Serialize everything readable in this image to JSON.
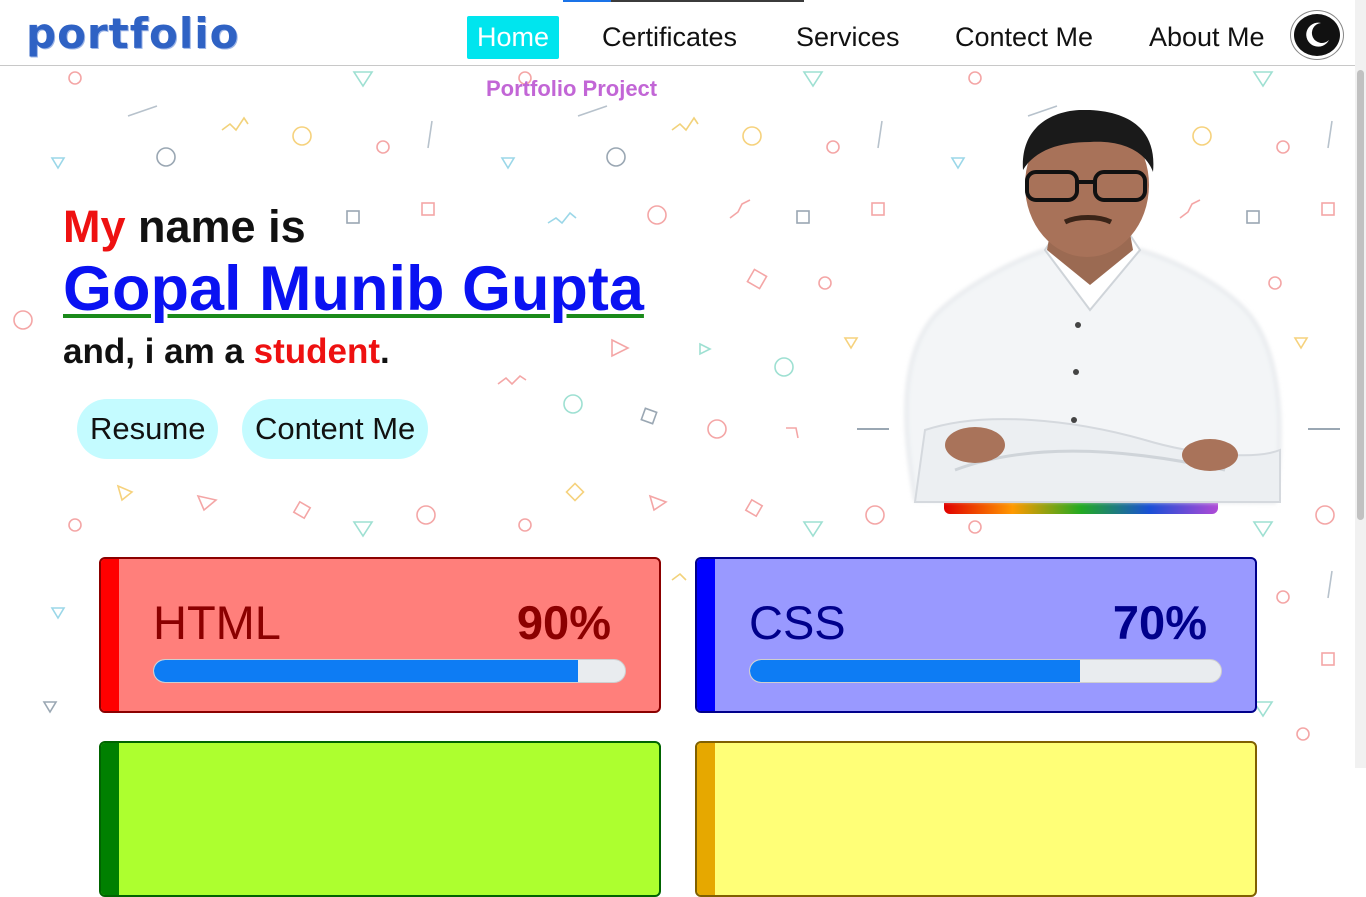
{
  "logo": {
    "text": "portfolio"
  },
  "nav": {
    "items": [
      {
        "label": "Home",
        "active": true
      },
      {
        "label": "Certificates",
        "active": false
      },
      {
        "label": "Services",
        "active": false
      },
      {
        "label": "Contect Me",
        "active": false
      },
      {
        "label": "About Me",
        "active": false
      }
    ],
    "theme_toggle_icon": "moon-icon"
  },
  "hero": {
    "project_label": "Portfolio Project",
    "intro_highlight": "My",
    "intro_rest": " name is",
    "name": "Gopal Munib Gupta",
    "role_prefix": "and, i am a ",
    "role_highlight": "student",
    "role_suffix": ".",
    "buttons": {
      "resume": "Resume",
      "contact": "Content Me"
    }
  },
  "skills": [
    {
      "name": "HTML",
      "percent_label": "90%",
      "level": 0.9,
      "bg": "#ff7f7b",
      "accent": "#ff0000",
      "text": "#8b0000"
    },
    {
      "name": "CSS",
      "percent_label": "70%",
      "level": 0.7,
      "bg": "#9999ff",
      "accent": "#0000ff",
      "text": "#00008b"
    },
    {
      "name": "",
      "percent_label": "",
      "bg": "#adff2f",
      "accent": "#008000",
      "text": "#006400"
    },
    {
      "name": "",
      "percent_label": "",
      "bg": "#ffff77",
      "accent": "#e6a800",
      "text": "#806000"
    }
  ],
  "colors": {
    "brand": "#2f62c4",
    "active_nav": "#00e5ee",
    "name": "#0a12f2",
    "highlight": "#ee1111",
    "project_label": "#c266d6",
    "pill": "#c4fbff",
    "progress": "#0d7cf4"
  }
}
